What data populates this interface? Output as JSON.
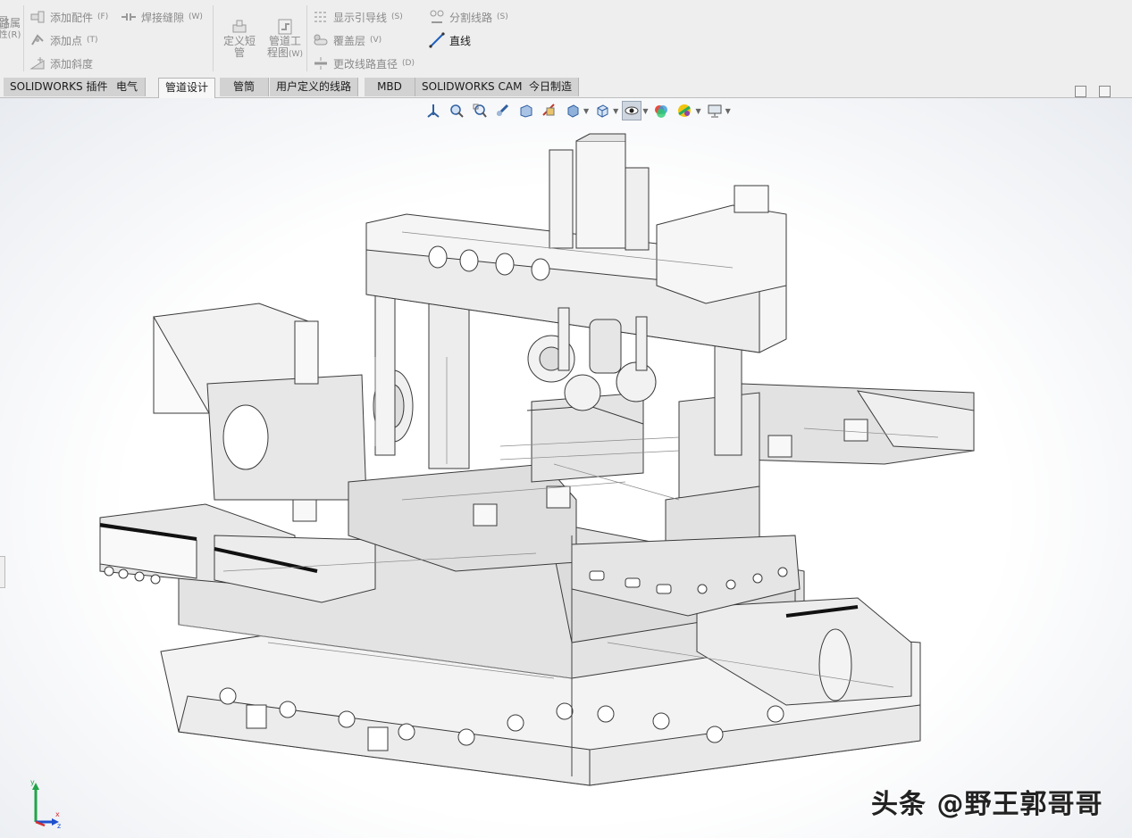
{
  "ribbon": {
    "group1_top": "路属",
    "group1_bottom": "性(R)",
    "add_assembly": {
      "label": "添加配件",
      "key": "(F)"
    },
    "add_point": {
      "label": "添加点",
      "key": "(T)"
    },
    "add_slope": {
      "label": "添加斜度",
      "key": ""
    },
    "weld_gap": {
      "label": "焊接缝隙",
      "key": "(W)"
    },
    "define_short_pipe": {
      "line1": "定义短",
      "line2": "管"
    },
    "pipe_drawing": {
      "line1": "管道工",
      "line2": "程图",
      "key": "(W)"
    },
    "show_guidelines": {
      "label": "显示引导线",
      "key": "(S)"
    },
    "cover_layer": {
      "label": "覆盖层",
      "key": "(V)"
    },
    "change_route_diameter": {
      "label": "更改线路直径",
      "key": "(D)"
    },
    "split_route": {
      "label": "分割线路",
      "key": "(S)"
    },
    "straight_line": {
      "label": "直线"
    }
  },
  "tabs": [
    {
      "label": "SOLIDWORKS 插件"
    },
    {
      "label": "电气"
    },
    {
      "label": "管道设计"
    },
    {
      "label": "管筒"
    },
    {
      "label": "用户定义的线路"
    },
    {
      "label": "MBD"
    },
    {
      "label": "SOLIDWORKS CAM"
    },
    {
      "label": "今日制造"
    }
  ],
  "active_tab": "管道设计",
  "hud_icons": [
    "view-orientation-icon",
    "zoom-to-fit-icon",
    "zoom-area-icon",
    "previous-view-icon",
    "section-view-icon",
    "dynamic-annotation-icon",
    "view-orientation-cube-icon",
    "display-style-icon",
    "hide-show-items-icon",
    "edit-appearance-icon",
    "apply-scene-icon",
    "view-settings-icon"
  ],
  "watermark": "头条 @野王郭哥哥",
  "triad": {
    "x": "x",
    "y": "y",
    "z": "z"
  },
  "colors": {
    "ribbon_bg": "#eeeeee",
    "tab_bg": "#d2d2d2",
    "tab_selected_bg": "#f7f7f7",
    "accent": "#1f5fbf"
  }
}
